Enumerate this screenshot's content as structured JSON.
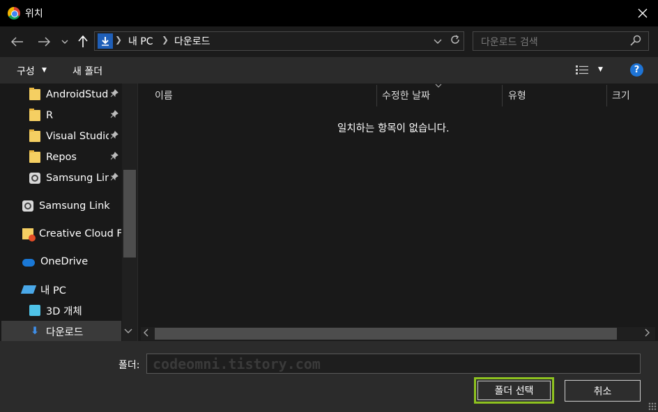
{
  "window": {
    "title": "위치",
    "close_glyph": "✕"
  },
  "nav": {
    "back_glyph": "←",
    "forward_glyph": "→",
    "history_glyph": "⌄",
    "up_glyph": "↑",
    "breadcrumb": [
      "내 PC",
      "다운로드"
    ],
    "search_placeholder": "다운로드 검색"
  },
  "toolbar": {
    "organize_label": "구성",
    "new_folder_label": "새 폴더",
    "help_label": "?"
  },
  "tree": {
    "items": [
      {
        "label": "AndroidStudi",
        "icon": "folder-icon",
        "pinned": true
      },
      {
        "label": "R",
        "icon": "folder-icon",
        "pinned": true
      },
      {
        "label": "Visual Studio",
        "icon": "folder-icon",
        "pinned": true
      },
      {
        "label": "Repos",
        "icon": "folder-icon",
        "pinned": true
      },
      {
        "label": "Samsung Linl",
        "icon": "samsung-link-icon",
        "pinned": true
      },
      {
        "label": "Samsung Link",
        "icon": "samsung-link-icon",
        "pinned": false
      },
      {
        "label": "Creative Cloud Fil",
        "icon": "creative-cloud-icon",
        "pinned": false
      },
      {
        "label": "OneDrive",
        "icon": "onedrive-icon",
        "pinned": false
      },
      {
        "label": "내 PC",
        "icon": "pc-icon",
        "pinned": false
      },
      {
        "label": "3D 개체",
        "icon": "3d-objects-icon",
        "pinned": false
      },
      {
        "label": "다운로드",
        "icon": "download-icon",
        "pinned": false,
        "selected": true
      }
    ],
    "pin_glyph": "📌"
  },
  "columns": [
    "이름",
    "수정한 날짜",
    "유형",
    "크기"
  ],
  "empty_message": "일치하는 항목이 없습니다.",
  "footer": {
    "folder_label": "폴더:",
    "folder_value": "codeomni.tistory.com",
    "select_button": "폴더 선택",
    "cancel_button": "취소"
  },
  "colors": {
    "accent_highlight": "#8ec21f",
    "help_blue": "#1e74d6"
  }
}
